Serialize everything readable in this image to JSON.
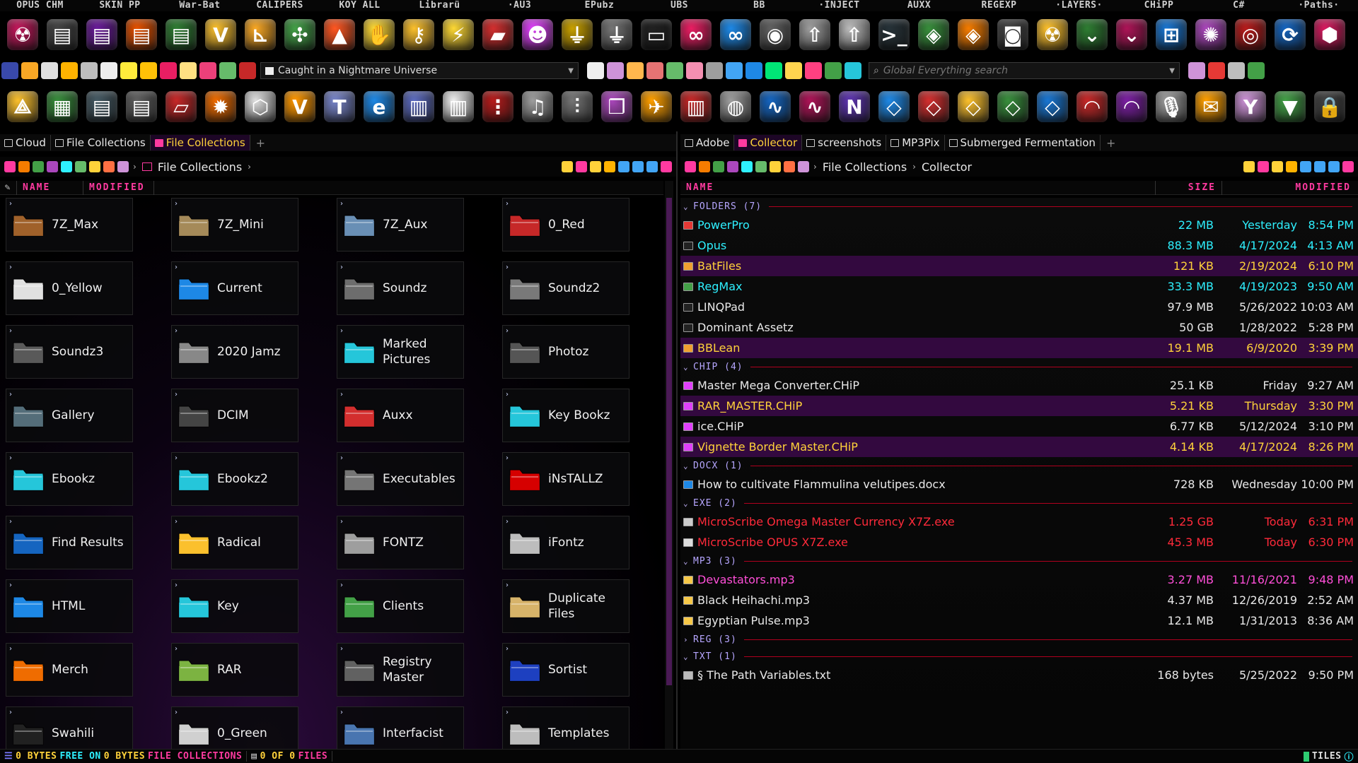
{
  "toolbar_labels": [
    "OPUS CHM",
    "SKIN PP",
    "War-Bat",
    "CALIPERS",
    "KOY ALL",
    "Librarü",
    "·AU3",
    "EPubz",
    "UBS",
    "BB",
    "·INJECT",
    "AUXX",
    "REGEXP",
    "·LAYERS·",
    "CHiPP",
    "C#",
    "·Paths·"
  ],
  "toolbar_row1": [
    {
      "icon": "radiation-icon",
      "color": "#c2185b",
      "glyph": "☢"
    },
    {
      "icon": "ram-module-icon",
      "color": "#444",
      "glyph": "▤"
    },
    {
      "icon": "ram-module-purple-icon",
      "color": "#6a1b9a",
      "glyph": "▤"
    },
    {
      "icon": "ram-module-orange-icon",
      "color": "#e65100",
      "glyph": "▤"
    },
    {
      "icon": "ram-module-green-icon",
      "color": "#2e7d32",
      "glyph": "▤"
    },
    {
      "icon": "v-logo-icon",
      "color": "#fbc02d",
      "glyph": "V"
    },
    {
      "icon": "calipers-icon",
      "color": "#f9a825",
      "glyph": "⊾"
    },
    {
      "icon": "molecule-icon",
      "color": "#43a047",
      "glyph": "✣"
    },
    {
      "icon": "triangle-logo-icon",
      "color": "#ff5722",
      "glyph": "▲"
    },
    {
      "icon": "hand-icon",
      "color": "#fdd835",
      "glyph": "✋"
    },
    {
      "icon": "key-icon",
      "color": "#fbc02d",
      "glyph": "⚷"
    },
    {
      "icon": "lightning-icon",
      "color": "#fdd835",
      "glyph": "⚡"
    },
    {
      "icon": "red-card-icon",
      "color": "#d32f2f",
      "glyph": "▰"
    },
    {
      "icon": "clown-icon",
      "color": "#e040fb",
      "glyph": "☻"
    },
    {
      "icon": "usb-gold-icon",
      "color": "#c8a000",
      "glyph": "⏚"
    },
    {
      "icon": "usb-silver-icon",
      "color": "#757575",
      "glyph": "⏚"
    },
    {
      "icon": "monitor-icon",
      "color": "#212121",
      "glyph": "▭"
    },
    {
      "icon": "infinity-pink-icon",
      "color": "#e91e63",
      "glyph": "∞"
    },
    {
      "icon": "infinity-blue-icon",
      "color": "#1e88e5",
      "glyph": "∞"
    },
    {
      "icon": "knob-icon",
      "color": "#616161",
      "glyph": "◉"
    },
    {
      "icon": "inject-arrow-icon",
      "color": "#9e9e9e",
      "glyph": "⇧"
    },
    {
      "icon": "inject-arrow2-icon",
      "color": "#bdbdbd",
      "glyph": "⇧"
    },
    {
      "icon": "terminal-icon",
      "color": "#263238",
      "glyph": ">_"
    },
    {
      "icon": "layers-green-icon",
      "color": "#388e3c",
      "glyph": "◈"
    },
    {
      "icon": "layers-orange-icon",
      "color": "#f57c00",
      "glyph": "◈"
    },
    {
      "icon": "camera-icon",
      "color": "#424242",
      "glyph": "◙"
    },
    {
      "icon": "hazard-icon",
      "color": "#fbc02d",
      "glyph": "☢"
    },
    {
      "icon": "chevron-down-green-icon",
      "color": "#2e7d32",
      "glyph": "⌄"
    },
    {
      "icon": "chevron-down-pink-icon",
      "color": "#ad1457",
      "glyph": "⌄"
    },
    {
      "icon": "windows-logo-icon",
      "color": "#1976d2",
      "glyph": "⊞"
    },
    {
      "icon": "pinwheel-icon",
      "color": "#ab47bc",
      "glyph": "✺"
    },
    {
      "icon": "eye-sphere-icon",
      "color": "#b71c1c",
      "glyph": "◎"
    },
    {
      "icon": "paths-icon",
      "color": "#1565c0",
      "glyph": "⟳"
    },
    {
      "icon": "cube-icon",
      "color": "#d81b60",
      "glyph": "⬢"
    }
  ],
  "toolbar_row3": [
    {
      "icon": "delta-logo-icon",
      "color": "#fbc02d",
      "glyph": "⟁"
    },
    {
      "icon": "green-blocks-icon",
      "color": "#388e3c",
      "glyph": "▦"
    },
    {
      "icon": "drive-teal-icon",
      "color": "#455a64",
      "glyph": "▤"
    },
    {
      "icon": "drive-gray-icon",
      "color": "#616161",
      "glyph": "▤"
    },
    {
      "icon": "eraser-icon",
      "color": "#c62828",
      "glyph": "▱"
    },
    {
      "icon": "flame-icon",
      "color": "#ef6c00",
      "glyph": "✹"
    },
    {
      "icon": "box3d-icon",
      "color": "#e0e0e0",
      "glyph": "⬡"
    },
    {
      "icon": "v-shield-icon",
      "color": "#ff9800",
      "glyph": "V"
    },
    {
      "icon": "font-tt-icon",
      "color": "#7986cb",
      "glyph": "T"
    },
    {
      "icon": "ie-logo-icon",
      "color": "#1e88e5",
      "glyph": "e"
    },
    {
      "icon": "equalizer-icon",
      "color": "#5c6bc0",
      "glyph": "▥"
    },
    {
      "icon": "piano-icon",
      "color": "#eeeeee",
      "glyph": "▥"
    },
    {
      "icon": "mixer-icon",
      "color": "#b71c1c",
      "glyph": "⋮"
    },
    {
      "icon": "headphones-icon",
      "color": "#9e9e9e",
      "glyph": "♫"
    },
    {
      "icon": "sliders-icon",
      "color": "#757575",
      "glyph": "⫶"
    },
    {
      "icon": "windows-stack-icon",
      "color": "#ab47bc",
      "glyph": "❐"
    },
    {
      "icon": "wings-icon",
      "color": "#ffa000",
      "glyph": "✈"
    },
    {
      "icon": "books-icon",
      "color": "#c62828",
      "glyph": "▥"
    },
    {
      "icon": "globe-icon",
      "color": "#9e9e9e",
      "glyph": "◍"
    },
    {
      "icon": "waveform-blue-icon",
      "color": "#1565c0",
      "glyph": "∿"
    },
    {
      "icon": "waveform-pink-icon",
      "color": "#ad1457",
      "glyph": "∿"
    },
    {
      "icon": "wave-n-icon",
      "color": "#5e35b1",
      "glyph": "N"
    },
    {
      "icon": "tablet-blue-icon",
      "color": "#1e88e5",
      "glyph": "◇"
    },
    {
      "icon": "tablet-red-icon",
      "color": "#d32f2f",
      "glyph": "◇"
    },
    {
      "icon": "tablet-yellow-icon",
      "color": "#fbc02d",
      "glyph": "◇"
    },
    {
      "icon": "tablet-green-icon",
      "color": "#388e3c",
      "glyph": "◇"
    },
    {
      "icon": "tablet-blue2-icon",
      "color": "#1976d2",
      "glyph": "◇"
    },
    {
      "icon": "mound-red-icon",
      "color": "#c62828",
      "glyph": "◠"
    },
    {
      "icon": "mound-purple-icon",
      "color": "#7b1fa2",
      "glyph": "◠"
    },
    {
      "icon": "microphone-icon",
      "color": "#9e9e9e",
      "glyph": "🎙"
    },
    {
      "icon": "envelope-icon",
      "color": "#ffa000",
      "glyph": "✉"
    },
    {
      "icon": "y-logo-icon",
      "color": "#ce93d8",
      "glyph": "Y"
    },
    {
      "icon": "rainbow-shield-icon",
      "color": "#43a047",
      "glyph": "▼"
    },
    {
      "icon": "padlock-icon",
      "color": "#424242",
      "glyph": "🔒"
    }
  ],
  "context_combo": {
    "value": "Caught in a Nightmare Universe"
  },
  "search": {
    "placeholder": "Global Everything search"
  },
  "left_pane": {
    "tabs": [
      {
        "label": "Cloud",
        "active": false
      },
      {
        "label": "File Collections",
        "active": false
      },
      {
        "label": "File Collections",
        "active": true
      }
    ],
    "path": [
      "File Collections"
    ],
    "columns": [
      "NAME",
      "MODIFIED"
    ],
    "tiles": [
      {
        "name": "7Z_Max",
        "icon": "folder-brown-icon",
        "color": "#a0622b"
      },
      {
        "name": "7Z_Mini",
        "icon": "folder-tan-icon",
        "color": "#a58a5a"
      },
      {
        "name": "7Z_Aux",
        "icon": "folder-steel-icon",
        "color": "#6a8fb5"
      },
      {
        "name": "0_Red",
        "icon": "folder-red-icon",
        "color": "#c62828"
      },
      {
        "name": "0_Yellow",
        "icon": "folder-white-icon",
        "color": "#e0e0e0"
      },
      {
        "name": "Current",
        "icon": "folder-globe-icon",
        "color": "#1e88e5"
      },
      {
        "name": "Soundz",
        "icon": "headphones-icon",
        "color": "#6d6d6d"
      },
      {
        "name": "Soundz2",
        "icon": "headphones-icon",
        "color": "#7a7a7a"
      },
      {
        "name": "Soundz3",
        "icon": "headphones-icon",
        "color": "#5a5a5a"
      },
      {
        "name": "2020 Jamz",
        "icon": "headphones-icon",
        "color": "#888"
      },
      {
        "name": "Marked Pictures",
        "icon": "folder-cyan-icon",
        "color": "#26c6da"
      },
      {
        "name": "Photoz",
        "icon": "camera-icon",
        "color": "#555"
      },
      {
        "name": "Gallery",
        "icon": "usb-drive-icon",
        "color": "#546e7a"
      },
      {
        "name": "DCIM",
        "icon": "camera-icon",
        "color": "#444"
      },
      {
        "name": "Auxx",
        "icon": "mail-box-icon",
        "color": "#d32f2f"
      },
      {
        "name": "Key Bookz",
        "icon": "folder-cyan-icon",
        "color": "#26c6da"
      },
      {
        "name": "Ebookz",
        "icon": "folder-cyan-icon",
        "color": "#26c6da"
      },
      {
        "name": "Ebookz2",
        "icon": "folder-cyan-icon",
        "color": "#26c6da"
      },
      {
        "name": "Executables",
        "icon": "gear-disc-icon",
        "color": "#757575"
      },
      {
        "name": "iNsTALLZ",
        "icon": "install-arrow-icon",
        "color": "#d50000"
      },
      {
        "name": "Find Results",
        "icon": "earth-icon",
        "color": "#1565c0"
      },
      {
        "name": "Radical",
        "icon": "drawer-icon",
        "color": "#fbc02d"
      },
      {
        "name": "FONTZ",
        "icon": "font-folder-icon",
        "color": "#9e9e9e"
      },
      {
        "name": "iFontz",
        "icon": "font-folder-icon",
        "color": "#bdbdbd"
      },
      {
        "name": "HTML",
        "icon": "globe-window-icon",
        "color": "#1e88e5"
      },
      {
        "name": "Key",
        "icon": "folder-cyan-icon",
        "color": "#26c6da"
      },
      {
        "name": "Clients",
        "icon": "folder-green-icon",
        "color": "#43a047"
      },
      {
        "name": "Duplicate Files",
        "icon": "folder-tan-icon",
        "color": "#d7b36a"
      },
      {
        "name": "Merch",
        "icon": "folder-orange-icon",
        "color": "#ef6c00"
      },
      {
        "name": "RAR",
        "icon": "folder-rainbow-icon",
        "color": "#7cb342"
      },
      {
        "name": "Registry Master",
        "icon": "registry-icon",
        "color": "#616161"
      },
      {
        "name": "Sortist",
        "icon": "folder-blue-icon",
        "color": "#1e40c0"
      },
      {
        "name": "Swahili",
        "icon": "folder-black-icon",
        "color": "#222"
      },
      {
        "name": "0_Green",
        "icon": "folder-white-icon",
        "color": "#d0d0d0"
      },
      {
        "name": "Interfacist",
        "icon": "folder-steel-icon",
        "color": "#4a76b0"
      },
      {
        "name": "Templates",
        "icon": "templates-icon",
        "color": "#bdbdbd"
      }
    ]
  },
  "right_pane": {
    "tabs": [
      {
        "label": "Adobe",
        "active": false
      },
      {
        "label": "Collector",
        "active": true
      },
      {
        "label": "screenshots",
        "active": false
      },
      {
        "label": "MP3Pix",
        "active": false
      },
      {
        "label": "Submerged Fermentation",
        "active": false
      }
    ],
    "path": [
      "File Collections",
      "Collector"
    ],
    "columns": [
      "NAME",
      "SIZE",
      "MODIFIED"
    ],
    "groups": [
      {
        "label": "FOLDERS (7)",
        "expanded": true,
        "rows": [
          {
            "name": "PowerPro",
            "size": "22 MB",
            "date": "Yesterday",
            "time": "8:54 PM",
            "color": "#2ef0ff",
            "icon": "#e53935",
            "hl": false
          },
          {
            "name": "Opus",
            "size": "88.3 MB",
            "date": "4/17/2024",
            "time": "4:13 AM",
            "color": "#2ef0ff",
            "icon": "#222",
            "hl": false
          },
          {
            "name": "BatFiles",
            "size": "121 KB",
            "date": "2/19/2024",
            "time": "6:10 PM",
            "color": "#ffd23a",
            "icon": "#f0a030",
            "hl": true
          },
          {
            "name": "RegMax",
            "size": "33.3 MB",
            "date": "4/19/2023",
            "time": "9:50 AM",
            "color": "#2ef0ff",
            "icon": "#43a047",
            "hl": false
          },
          {
            "name": "LINQPad",
            "size": "97.9 MB",
            "date": "5/26/2022",
            "time": "10:03 AM",
            "color": "#e8e8e8",
            "icon": "#222",
            "hl": false
          },
          {
            "name": "Dominant Assetz",
            "size": "50 GB",
            "date": "1/28/2022",
            "time": "5:28 PM",
            "color": "#e8e8e8",
            "icon": "#222",
            "hl": false
          },
          {
            "name": "BBLean",
            "size": "19.1 MB",
            "date": "6/9/2020",
            "time": "3:39 PM",
            "color": "#ffd23a",
            "icon": "#f0a030",
            "hl": true
          }
        ]
      },
      {
        "label": "CHIP (4)",
        "expanded": true,
        "rows": [
          {
            "name": "Master Mega Converter.CHiP",
            "size": "25.1 KB",
            "date": "Friday",
            "time": "9:27 AM",
            "color": "#e8e8e8",
            "icon": "#e040fb",
            "hl": false
          },
          {
            "name": "RAR_MASTER.CHiP",
            "size": "5.21 KB",
            "date": "Thursday",
            "time": "3:30 PM",
            "color": "#ffd23a",
            "icon": "#e040fb",
            "hl": true
          },
          {
            "name": "ice.CHiP",
            "size": "6.77 KB",
            "date": "5/12/2024",
            "time": "3:10 PM",
            "color": "#e8e8e8",
            "icon": "#e040fb",
            "hl": false
          },
          {
            "name": "Vignette Border Master.CHiP",
            "size": "4.14 KB",
            "date": "4/17/2024",
            "time": "8:26 PM",
            "color": "#ffd23a",
            "icon": "#e040fb",
            "hl": true
          }
        ]
      },
      {
        "label": "DOCX (1)",
        "expanded": true,
        "rows": [
          {
            "name": "How to cultivate Flammulina velutipes.docx",
            "size": "728 KB",
            "date": "Wednesday",
            "time": "10:00 PM",
            "color": "#e8e8e8",
            "icon": "#1e88e5",
            "hl": false
          }
        ]
      },
      {
        "label": "EXE (2)",
        "expanded": true,
        "rows": [
          {
            "name": "MicroScribe Omega Master Currency X7Z.exe",
            "size": "1.25 GB",
            "date": "Today",
            "time": "6:31 PM",
            "color": "#ff2a3a",
            "icon": "#ccc",
            "hl": false
          },
          {
            "name": "MicroScribe OPUS X7Z.exe",
            "size": "45.3 MB",
            "date": "Today",
            "time": "6:30 PM",
            "color": "#ff2a3a",
            "icon": "#ddd",
            "hl": false
          }
        ]
      },
      {
        "label": "MP3 (3)",
        "expanded": true,
        "rows": [
          {
            "name": "Devastators.mp3",
            "size": "3.27 MB",
            "date": "11/16/2021",
            "time": "9:48 PM",
            "color": "#ff4fd8",
            "icon": "#f7c948",
            "hl": false
          },
          {
            "name": "Black Heihachi.mp3",
            "size": "4.37 MB",
            "date": "12/26/2019",
            "time": "2:52 AM",
            "color": "#e8e8e8",
            "icon": "#f7c948",
            "hl": false
          },
          {
            "name": "Egyptian Pulse.mp3",
            "size": "12.1 MB",
            "date": "1/31/2013",
            "time": "8:36 AM",
            "color": "#e8e8e8",
            "icon": "#f7c948",
            "hl": false
          }
        ]
      },
      {
        "label": "REG (3)",
        "expanded": false,
        "rows": []
      },
      {
        "label": "TXT (1)",
        "expanded": true,
        "rows": [
          {
            "name": "§ The Path Variables.txt",
            "size": "168 bytes",
            "date": "5/25/2022",
            "time": "9:50 PM",
            "color": "#e8e8e8",
            "icon": "#bbb",
            "hl": false
          }
        ]
      }
    ]
  },
  "status": {
    "free_a": "0 BYTES",
    "free_label": "FREE ON",
    "free_b": "0 BYTES",
    "location": "FILE COLLECTIONS",
    "count": "0 OF 0",
    "files_label": "FILES",
    "view_mode": "TILES"
  },
  "colors": {
    "accent": "#ff3aa0",
    "highlight": "#33093f",
    "group_line": "#b0001e",
    "yellow": "#ffd23a",
    "cyan": "#2ef0ff"
  }
}
